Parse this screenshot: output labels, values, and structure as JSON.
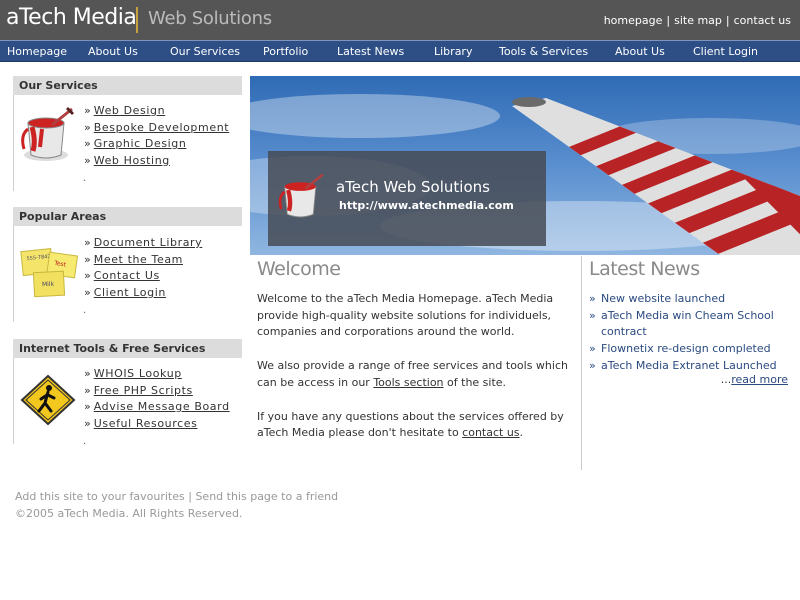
{
  "header": {
    "logo_main": "aTech Media",
    "logo_sub": "Web Solutions",
    "toplinks": [
      "homepage",
      "site map",
      "contact us"
    ],
    "separator": "|"
  },
  "nav": [
    "Homepage",
    "About Us",
    "Our Services",
    "Portfolio",
    "Latest News",
    "Library",
    "Tools & Services",
    "About Us",
    "Client Login"
  ],
  "left": {
    "services": {
      "title": "Our Services",
      "icon": "paint-bucket-icon",
      "items": [
        "Web Design",
        "Bespoke Development",
        "Graphic Design",
        "Web Hosting"
      ]
    },
    "popular": {
      "title": "Popular Areas",
      "icon": "sticky-notes-icon",
      "note_text": [
        "555-7842",
        "Test",
        "Milk"
      ],
      "items": [
        "Document Library",
        "Meet the Team",
        "Contact Us",
        "Client Login"
      ]
    },
    "tools": {
      "title": "Internet Tools & Free Services",
      "icon": "pedestrian-sign-icon",
      "items": [
        "WHOIS Lookup",
        "Free PHP Scripts",
        "Advise Message Board",
        "Useful Resources"
      ]
    },
    "arrow": "»",
    "dot": "."
  },
  "banner": {
    "title": "aTech Web Solutions",
    "url": "http://www.atechmedia.com"
  },
  "welcome": {
    "title": "Welcome",
    "p1": "Welcome to the aTech Media Homepage. aTech Media provide high-quality website solutions for individuels, companies and corporations around the world.",
    "p2_before": "We also provide a range of free services and tools which can be access in our ",
    "p2_link": "Tools section",
    "p2_after": " of the site.",
    "p3_before": "If you have any questions about the services offered by aTech Media please don't hesitate to ",
    "p3_link": "contact us",
    "p3_after": "."
  },
  "news": {
    "title": "Latest News",
    "items": [
      "New website launched",
      "aTech Media win Cheam School contract",
      "Flownetix re-design completed",
      "aTech Media Extranet Launched"
    ],
    "more_prefix": "...",
    "more_link": "read more"
  },
  "footer": {
    "fav": "Add this site to your favourites",
    "sep": "|",
    "send": "Send this page to a friend",
    "copyright": "©2005 aTech Media. All Rights Reserved."
  },
  "colors": {
    "header_bg": "#555555",
    "nav_bg": "#2e4e86",
    "news_link": "#2a4a80",
    "box_head_bg": "#dcdcdc"
  }
}
